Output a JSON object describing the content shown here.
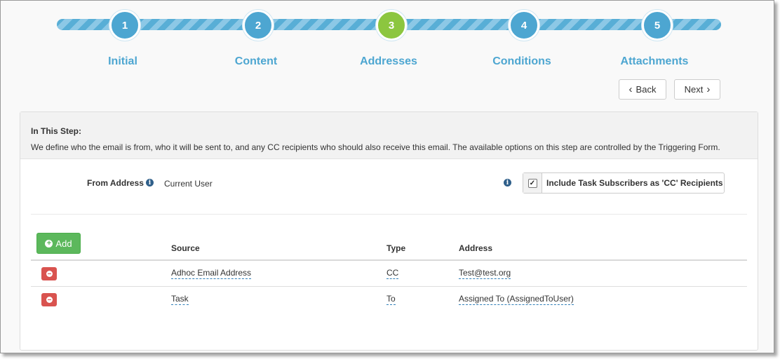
{
  "wizard": {
    "steps": [
      {
        "number": "1",
        "label": "Initial"
      },
      {
        "number": "2",
        "label": "Content"
      },
      {
        "number": "3",
        "label": "Addresses"
      },
      {
        "number": "4",
        "label": "Conditions"
      },
      {
        "number": "5",
        "label": "Attachments"
      }
    ],
    "active_step": 3,
    "back_label": "Back",
    "next_label": "Next"
  },
  "colors": {
    "step": "#4da6d1",
    "active_step": "#8cc63f",
    "add_button": "#5cb85c",
    "delete_button": "#d9534f"
  },
  "info": {
    "heading": "In This Step:",
    "text": "We define who the email is from, who it will be sent to, and any CC recipients who should also receive this email. The available options on this step are controlled by the Triggering Form."
  },
  "from": {
    "label": "From Address",
    "value": "Current User"
  },
  "cc_option": {
    "label": "Include Task Subscribers as 'CC' Recipients",
    "checked": true
  },
  "table": {
    "add_label": "Add",
    "headers": {
      "source": "Source",
      "type": "Type",
      "address": "Address"
    },
    "rows": [
      {
        "source": "Adhoc Email Address",
        "type": "CC",
        "address": "Test@test.org"
      },
      {
        "source": "Task",
        "type": "To",
        "address": "Assigned To (AssignedToUser)"
      }
    ]
  }
}
